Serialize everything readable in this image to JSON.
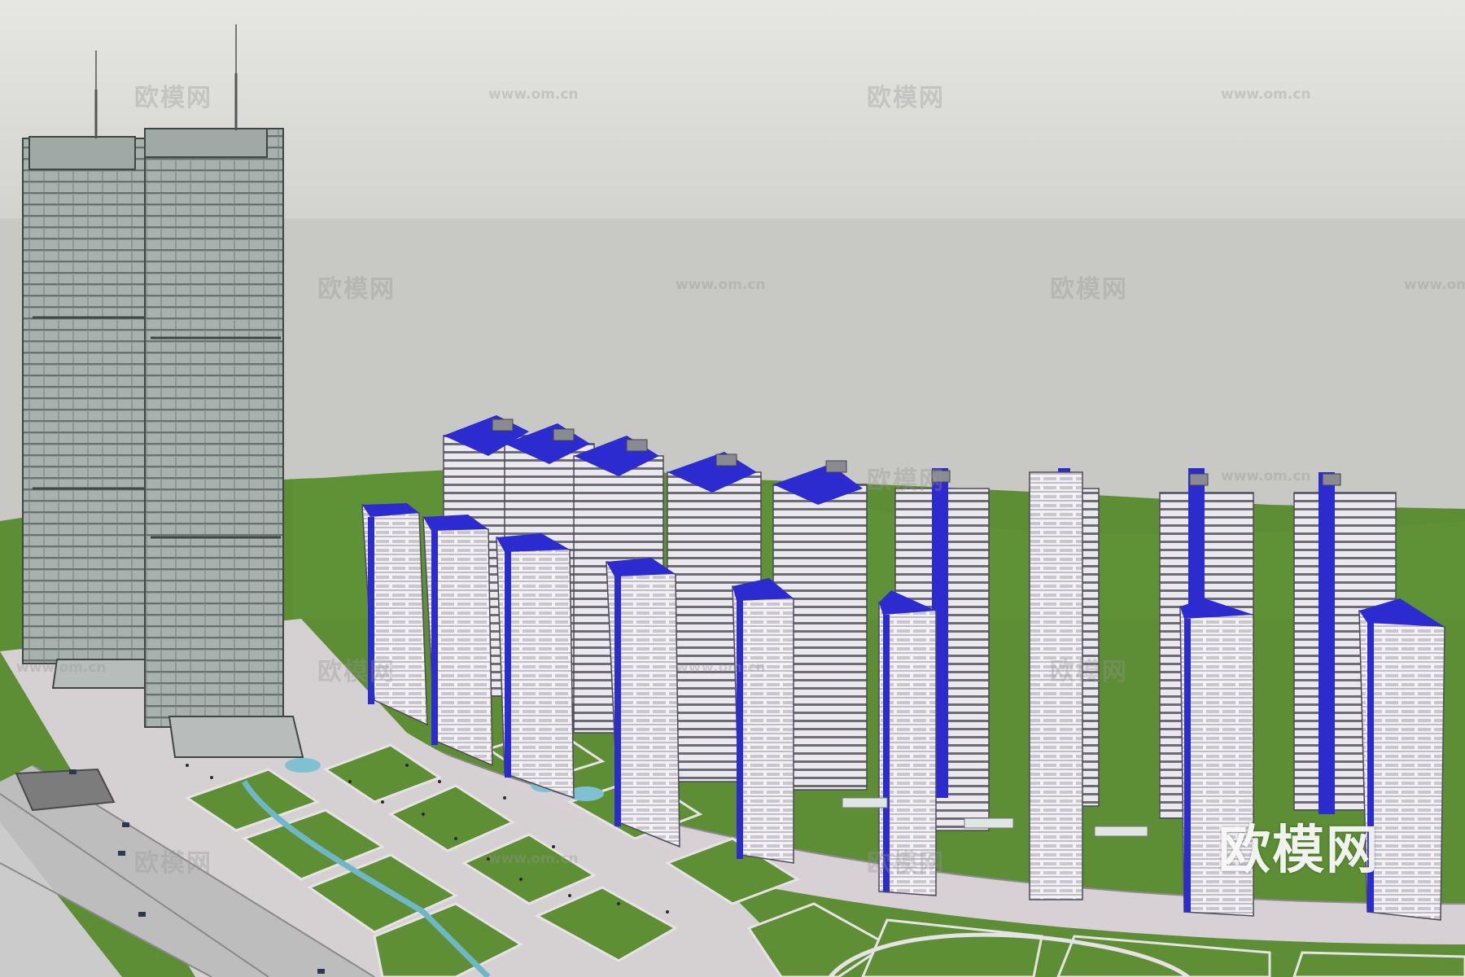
{
  "watermark": {
    "text_cn": "欧模网",
    "text_url": "www.om.cn",
    "logo_text": "欧模网"
  },
  "colors": {
    "sky_top": "#e6e6e3",
    "sky_bottom": "#cfd0cc",
    "ground_far": "#c8c9c4",
    "grass": "#5f8f36",
    "plaza": "#d9d3d6",
    "road": "#b9b9b9",
    "water": "#6fb7c7",
    "glass_tower": "#8f9a97",
    "residential": "#f2eff3",
    "accent_blue": "#2b2bd0"
  }
}
